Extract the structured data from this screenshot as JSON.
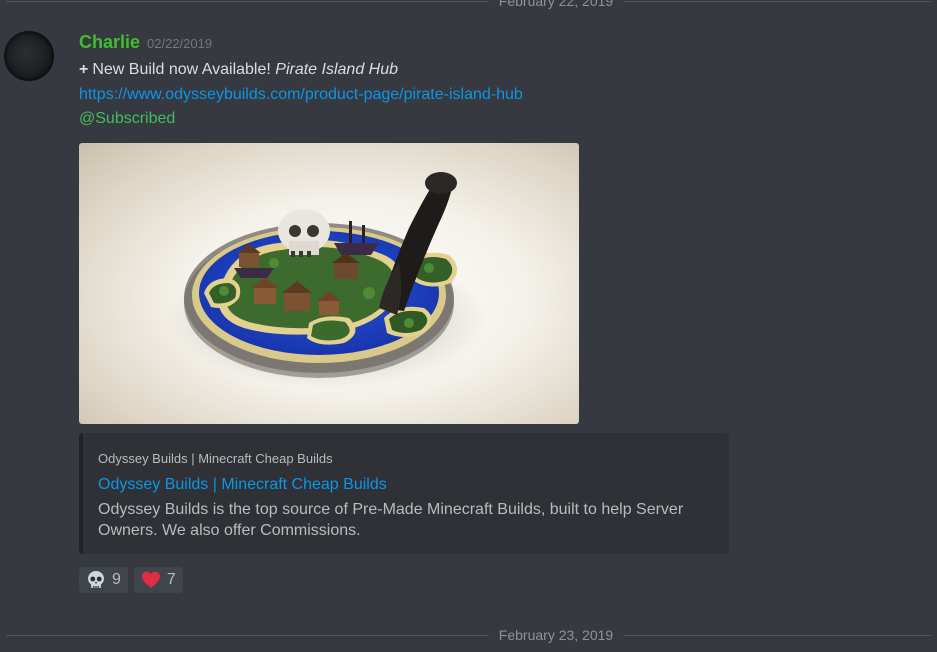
{
  "dividers": {
    "top_date": "February 22, 2019",
    "bottom_date": "February 23, 2019"
  },
  "message": {
    "author": "Charlie",
    "timestamp": "02/22/2019",
    "plus_symbol": "+",
    "announcement": "New Build now Available!",
    "build_name": "Pirate Island Hub",
    "url": "https://www.odysseybuilds.com/product-page/pirate-island-hub",
    "mention": "@Subscribed"
  },
  "embed": {
    "provider": "Odyssey Builds | Minecraft Cheap Builds",
    "title": "Odyssey Builds | Minecraft Cheap Builds",
    "description": "Odyssey Builds is the top source of Pre-Made Minecraft Builds, built to help Server Owners. We also offer Commissions."
  },
  "reactions": [
    {
      "icon": "skull-icon",
      "count": "9"
    },
    {
      "icon": "heart-icon",
      "count": "7"
    }
  ],
  "colors": {
    "background": "#36393f",
    "username": "#3fbf2f",
    "link": "#0b96e8",
    "mention": "#3fbf60",
    "embed_bg": "#2f3136",
    "reaction_bg": "#40444b",
    "heart": "#dd2e44"
  }
}
